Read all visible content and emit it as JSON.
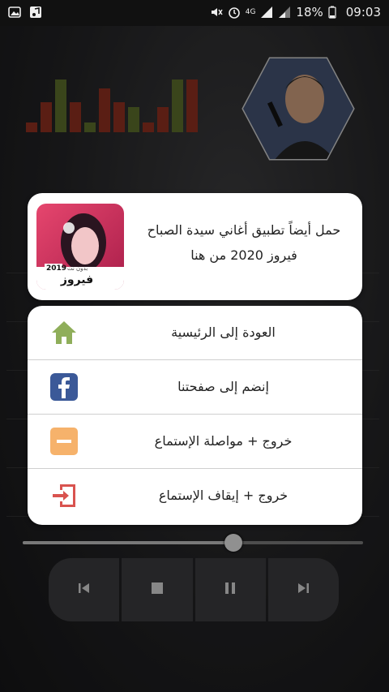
{
  "status_bar": {
    "signal_label": "4G",
    "battery": "18%",
    "time": "09:03"
  },
  "player": {
    "equalizer_colors": [
      "#8b2e1f",
      "#8b2e1f",
      "#5a6b2a",
      "#8b2e1f",
      "#5a6b2a",
      "#8b2e1f",
      "#8b2e1f",
      "#5a6b2a",
      "#8b2e1f",
      "#8b2e1f",
      "#5a6b2a",
      "#8b2e1f"
    ],
    "equalizer_levels": [
      0.18,
      0.55,
      0.95,
      0.55,
      0.18,
      0.8,
      0.55,
      0.45,
      0.18,
      0.45,
      0.95,
      0.95
    ],
    "progress_fraction": 0.62,
    "controls": [
      "previous-icon",
      "stop-icon",
      "pause-icon",
      "next-icon"
    ]
  },
  "promo": {
    "text": "حمل أيضاً تطبيق أغاني سيدة الصباح فيروز 2020 من هنا",
    "image_year": "2019",
    "image_caption": "فيروز",
    "image_subcaption": "بدون نت"
  },
  "menu": {
    "items": [
      {
        "label": "العودة إلى الرئيسية",
        "icon": "home-icon",
        "color": "#8fae5a"
      },
      {
        "label": "إنضم إلى صفحتنا",
        "icon": "facebook-icon",
        "color": "#3b5998"
      },
      {
        "label": "خروج + مواصلة الإستماع",
        "icon": "minimize-icon",
        "color": "#f6b26b"
      },
      {
        "label": "خروج + إيقاف الإستماع",
        "icon": "exit-icon",
        "color": "#d9534f"
      }
    ]
  }
}
